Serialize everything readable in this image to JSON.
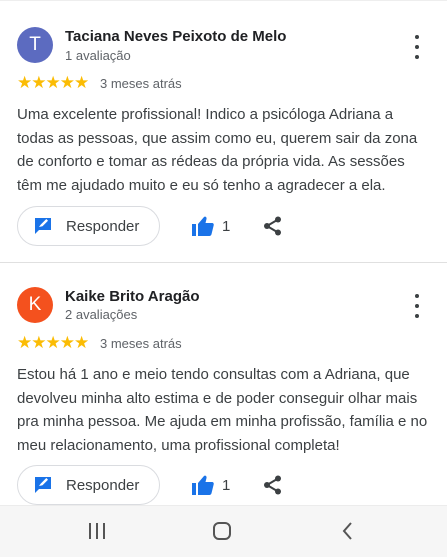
{
  "reviews": [
    {
      "avatar_letter": "T",
      "avatar_color": "#5c6bc0",
      "name": "Taciana Neves Peixoto de Melo",
      "review_count": "1 avaliação",
      "stars": "★★★★★",
      "rating": 5,
      "date": "3 meses atrás",
      "text": "Uma excelente profissional! Indico a psicóloga Adriana a todas as pessoas, que assim como eu, querem sair da zona de conforto e tomar as rédeas da própria vida. As sessões têm me ajudado muito e eu só tenho a agradecer a ela.",
      "reply_label": "Responder",
      "like_count": "1"
    },
    {
      "avatar_letter": "K",
      "avatar_color": "#f4511e",
      "name": "Kaike Brito Aragão",
      "review_count": "2 avaliações",
      "stars": "★★★★★",
      "rating": 5,
      "date": "3 meses atrás",
      "text": "Estou há 1 ano e meio tendo consultas com a Adriana, que devolveu minha alto estima e de poder conseguir olhar mais pra minha pessoa. Me ajuda em minha profissão, família e no meu relacionamento, uma profissional completa!",
      "reply_label": "Responder",
      "like_count": "1"
    }
  ],
  "colors": {
    "accent": "#1a73e8",
    "star": "#fbbc04"
  },
  "icons": [
    "more-vert-icon",
    "reply-icon",
    "thumb-up-icon",
    "share-icon",
    "recent-apps-icon",
    "home-icon",
    "back-icon"
  ]
}
